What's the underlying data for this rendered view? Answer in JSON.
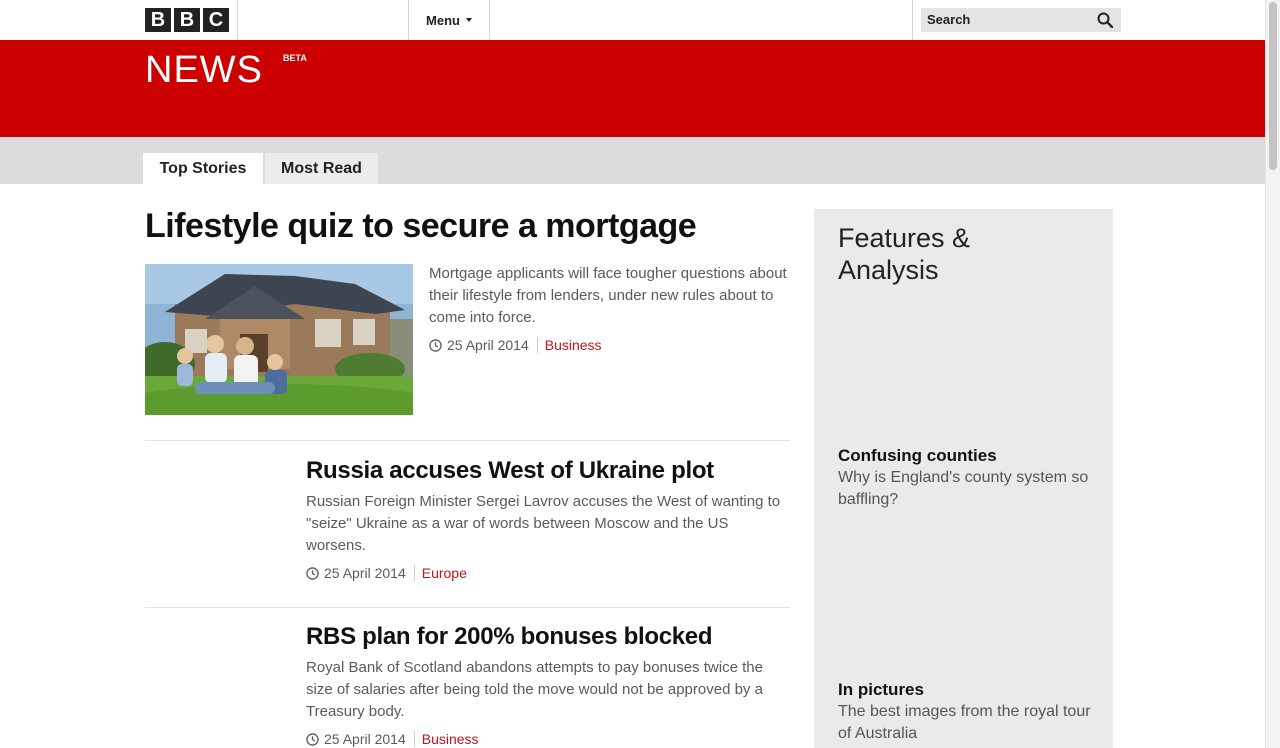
{
  "header": {
    "logo_letters": [
      "B",
      "B",
      "C"
    ],
    "menu_label": "Menu",
    "search_placeholder": "Search",
    "icons": {
      "search": "search-icon",
      "menu_caret": "chevron-down-icon"
    }
  },
  "masthead": {
    "title": "NEWS",
    "badge": "BETA",
    "brand_color": "#cc0000"
  },
  "tabs": [
    {
      "label": "Top Stories",
      "active": true
    },
    {
      "label": "Most Read",
      "active": false
    }
  ],
  "lead_story": {
    "title": "Lifestyle quiz to secure a mortgage",
    "summary": "Mortgage applicants will face tougher questions about their lifestyle from lenders, under new rules about to come into force.",
    "date": "25 April 2014",
    "section": "Business"
  },
  "stories": [
    {
      "title": "Russia accuses West of Ukraine plot",
      "summary": "Russian Foreign Minister Sergei Lavrov accuses the West of wanting to \"seize\" Ukraine as a war of words between Moscow and the US worsens.",
      "date": "25 April 2014",
      "section": "Europe"
    },
    {
      "title": "RBS plan for 200% bonuses blocked",
      "summary": "Royal Bank of Scotland abandons attempts to pay bonuses twice the size of salaries after being told the move would not be approved by a Treasury body.",
      "date": "25 April 2014",
      "section": "Business"
    }
  ],
  "features": {
    "heading": "Features & Analysis",
    "items": [
      {
        "title": "Confusing counties",
        "summary": "Why is England's county system so baffling?"
      },
      {
        "title": "In pictures",
        "summary": "The best images from the royal tour of Australia"
      }
    ]
  },
  "colors": {
    "accent_red": "#cc0000",
    "section_link": "#bb1919",
    "features_bg": "#eaeaea"
  }
}
